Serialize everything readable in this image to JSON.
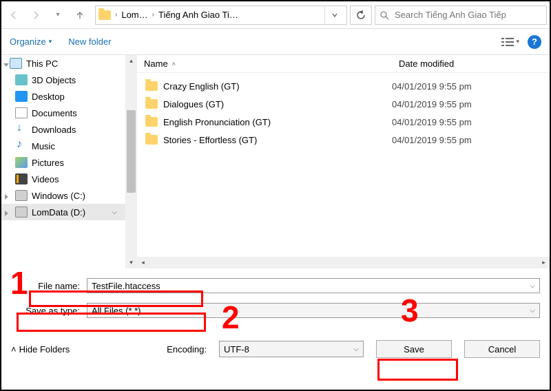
{
  "nav": {
    "path_segments": [
      "Lom…",
      "Tiếng Anh Giao Ti…"
    ],
    "search_placeholder": "Search Tiếng Anh Giao Tiếp"
  },
  "toolbar": {
    "organize": "Organize",
    "new_folder": "New folder"
  },
  "sidebar": {
    "items": [
      {
        "icon": "pc",
        "label": "This PC"
      },
      {
        "icon": "obj3d",
        "label": "3D Objects"
      },
      {
        "icon": "desktop",
        "label": "Desktop"
      },
      {
        "icon": "docs",
        "label": "Documents"
      },
      {
        "icon": "downloads",
        "label": "Downloads"
      },
      {
        "icon": "music",
        "label": "Music"
      },
      {
        "icon": "pictures",
        "label": "Pictures"
      },
      {
        "icon": "videos",
        "label": "Videos"
      },
      {
        "icon": "drive",
        "label": "Windows (C:)"
      },
      {
        "icon": "drive",
        "label": "LomData (D:)"
      }
    ]
  },
  "columns": {
    "name": "Name",
    "date": "Date modified"
  },
  "files": [
    {
      "name": "Crazy English (GT)",
      "date": "04/01/2019 9:55 pm"
    },
    {
      "name": "Dialogues (GT)",
      "date": "04/01/2019 9:55 pm"
    },
    {
      "name": "English Pronunciation (GT)",
      "date": "04/01/2019 9:55 pm"
    },
    {
      "name": "Stories - Effortless (GT)",
      "date": "04/01/2019 9:55 pm"
    }
  ],
  "fields": {
    "filename_label": "File name:",
    "filename_value": "TestFile.htaccess",
    "savetype_label": "Save as type:",
    "savetype_value": "All Files  (*.*)"
  },
  "footer": {
    "hide_folders": "Hide Folders",
    "encoding_label": "Encoding:",
    "encoding_value": "UTF-8",
    "save": "Save",
    "cancel": "Cancel"
  },
  "annotations": {
    "n1": "1",
    "n2": "2",
    "n3": "3"
  }
}
